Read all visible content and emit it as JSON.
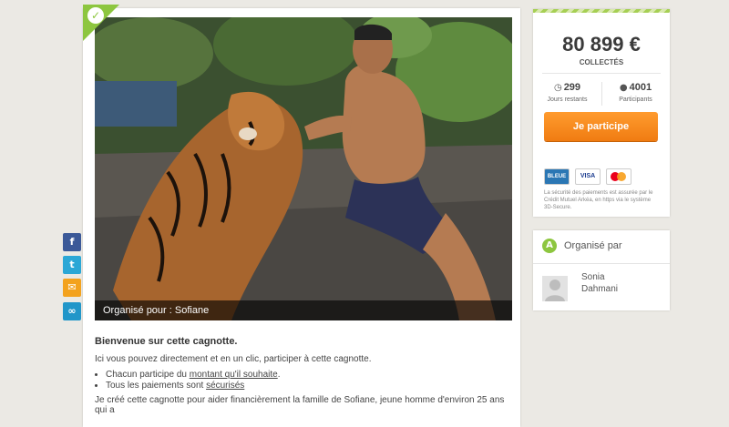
{
  "campaign": {
    "organized_for": "Organisé pour : Sofiane",
    "heading": "Bienvenue sur cette cagnotte.",
    "intro": "Ici vous pouvez directement et en un clic, participer à cette cagnotte.",
    "bullet1_prefix": "Chacun participe du ",
    "bullet1_link": "montant qu'il souhaite",
    "bullet1_suffix": ".",
    "bullet2_prefix": "Tous les paiements sont ",
    "bullet2_link": "sécurisés",
    "cut_text": "Je créé cette cagnotte pour aider financièrement la famille de Sofiane, jeune homme d'environ 25 ans qui a"
  },
  "stats": {
    "amount": "80 899 €",
    "collected_label": "COLLECTÉS",
    "days_value": "299",
    "days_label": "Jours restants",
    "participants_value": "4001",
    "participants_label": "Participants",
    "button_label": "Je participe",
    "security_text": "La sécurité des paiements est assurée par le Crédit Mutuel Arkéa, en https via le système 3D-Secure."
  },
  "payment_cards": {
    "cb": "BLEUE",
    "visa": "VISA",
    "mastercard_icon": "mastercard-icon"
  },
  "organizer": {
    "title": "Organisé par",
    "first_name": "Sonia",
    "last_name": "Dahmani"
  },
  "share": {
    "facebook": "f",
    "twitter": "t",
    "email": "✉",
    "link": "∞"
  },
  "colors": {
    "accent_green": "#8dc63f",
    "button_orange": "#f58a1f",
    "background": "#ebe9e4"
  }
}
